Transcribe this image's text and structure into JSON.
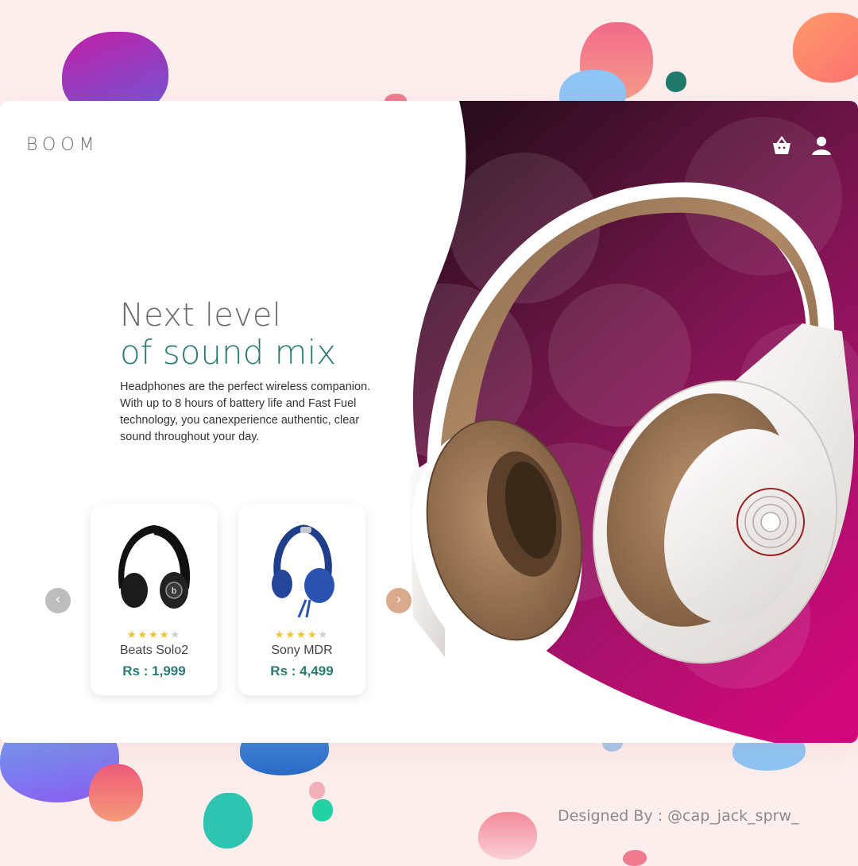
{
  "brand": {
    "logo": "BOOM"
  },
  "nav": {
    "cart_icon": "shopping-basket-icon",
    "user_icon": "user-icon"
  },
  "hero": {
    "headline_line1": "Next level",
    "headline_line2": "of sound mix",
    "description": "Headphones are the perfect wireless companion. With up to 8 hours of battery life and Fast Fuel technology, you canexperience authentic, clear sound throughout your day."
  },
  "carousel": {
    "prev_icon": "chevron-left-icon",
    "next_icon": "chevron-right-icon",
    "products": [
      {
        "name": "Beats Solo2",
        "price": "Rs : 1,999",
        "rating": 4,
        "max_rating": 5
      },
      {
        "name": "Sony MDR",
        "price": "Rs : 4,499",
        "rating": 4,
        "max_rating": 5
      }
    ]
  },
  "footer": {
    "credit": "Designed By : @cap_jack_sprw_"
  },
  "colors": {
    "accent_teal": "#2b7a73",
    "hero_magenta": "#c0106e",
    "hero_dark": "#2a0c1c",
    "next_arrow": "#d9a98c",
    "prev_arrow": "#bdbdbd",
    "star": "#f2c230"
  }
}
